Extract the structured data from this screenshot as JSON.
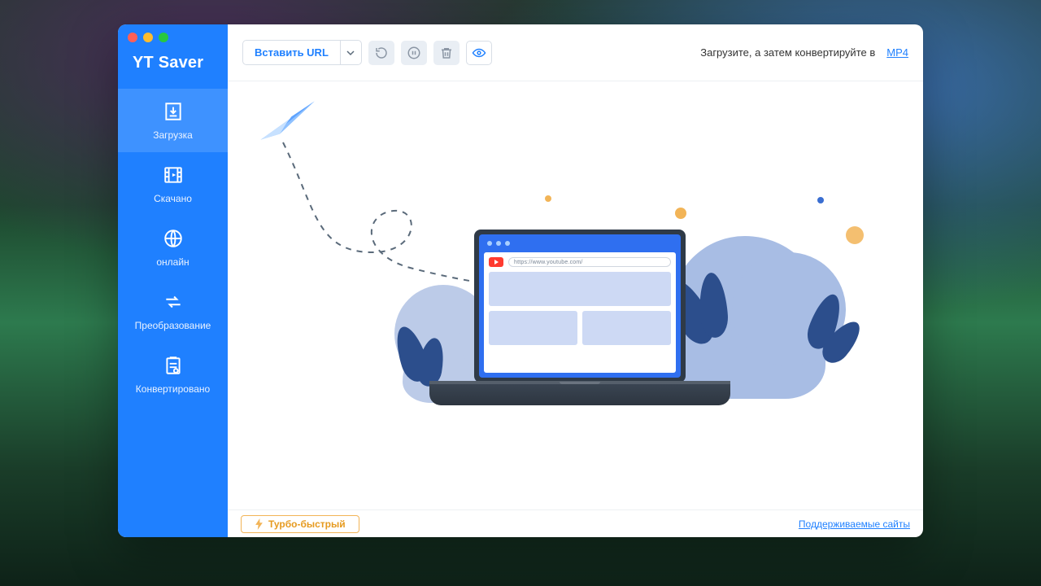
{
  "app": {
    "title": "YT Saver"
  },
  "sidebar": {
    "items": [
      {
        "id": "download",
        "label": "Загрузка",
        "icon": "download-icon"
      },
      {
        "id": "downloaded",
        "label": "Скачано",
        "icon": "film-icon"
      },
      {
        "id": "online",
        "label": "онлайн",
        "icon": "globe-icon"
      },
      {
        "id": "convert",
        "label": "Преобразование",
        "icon": "convert-icon"
      },
      {
        "id": "converted",
        "label": "Конвертировано",
        "icon": "clipboard-icon"
      }
    ],
    "active_index": 0
  },
  "toolbar": {
    "paste_url_label": "Вставить URL",
    "hint_text": "Загрузите, а затем конвертируйте в",
    "format": "MP4"
  },
  "illustration": {
    "browser_url_text": "https://www.youtube.com/"
  },
  "footer": {
    "turbo_label": "Турбо-быстрый",
    "supported_sites_label": "Поддерживаемые сайты"
  }
}
